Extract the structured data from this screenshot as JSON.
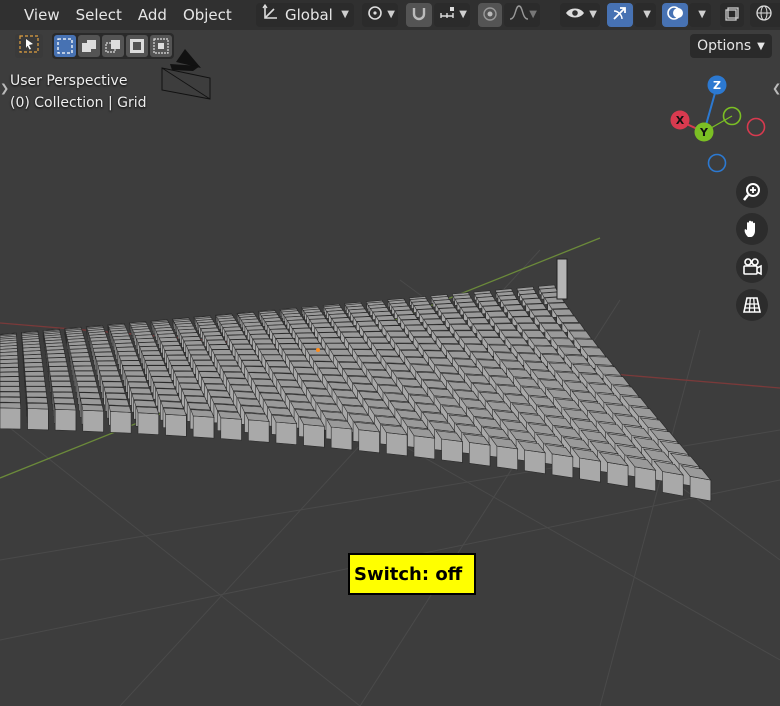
{
  "menu": {
    "view": "View",
    "select": "Select",
    "add": "Add",
    "object": "Object"
  },
  "toolbar": {
    "transform_orientation": "Global",
    "options_label": "Options"
  },
  "viewport": {
    "perspective_label": "User Perspective",
    "collection_label": "(0) Collection | Grid"
  },
  "gizmo": {
    "z_label": "Z",
    "x_label": "X",
    "y_label": "Y"
  },
  "switch": {
    "text": "Switch: off"
  },
  "colors": {
    "header_bg": "#303030",
    "viewport_bg": "#3d3d3d",
    "accent_blue": "#4772b3",
    "axis_x": "#d83a4f",
    "axis_y": "#7bbf24",
    "axis_z": "#2c79d1",
    "switch_bg": "#ffff00"
  },
  "icons": {
    "transform_orientation": "global-axes-icon",
    "pivot": "pivot-link-icon",
    "snap": "magnet-icon",
    "snap_increment": "increment-icon",
    "proportional": "proportional-circle-icon",
    "falloff": "falloff-curve-icon",
    "visibility": "eye-icon",
    "gizmos": "gizmo-arrow-icon",
    "overlays": "overlay-circles-icon",
    "xray": "xray-icon",
    "shading_wire": "wireframe-sphere-icon"
  }
}
